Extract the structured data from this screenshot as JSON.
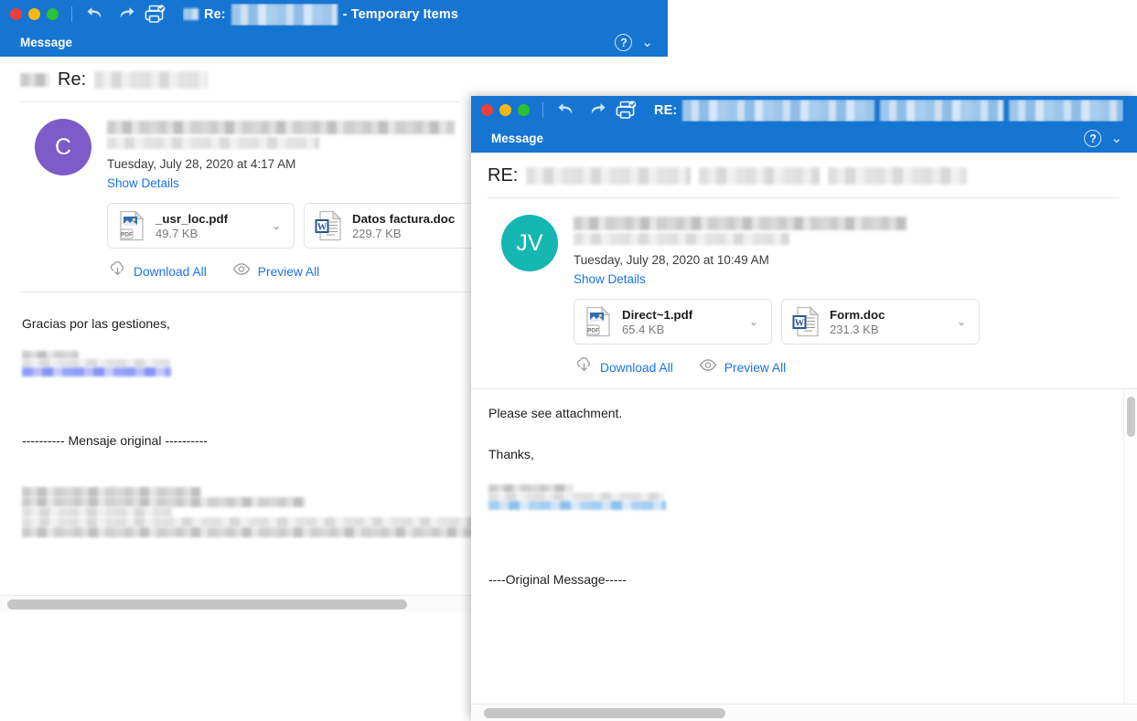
{
  "window1": {
    "titlebar": {
      "prefix_redacted": true,
      "subject_prefix": "Re:",
      "subject_suffix": "- Temporary Items",
      "menu_label": "Message",
      "help_icon": "question-mark-icon",
      "chevron_icon": "chevron-down-icon",
      "undo_icon": "undo-icon",
      "redo_icon": "redo-icon",
      "print_icon": "print-icon",
      "accent_color": "#1675d1"
    },
    "subject": {
      "prefix": "Re:"
    },
    "message": {
      "avatar_initials": "C",
      "avatar_color": "#7b5cc8",
      "date": "Tuesday, July 28, 2020 at 4:17 AM",
      "show_details": "Show Details",
      "attachments": [
        {
          "name": "_usr_loc.pdf",
          "size": "49.7 KB",
          "kind": "pdf"
        },
        {
          "name": "Datos factura.doc",
          "size": "229.7 KB",
          "kind": "doc"
        }
      ],
      "download_all": "Download All",
      "preview_all": "Preview All",
      "download_icon": "cloud-download-icon",
      "preview_icon": "eye-icon"
    },
    "body": {
      "greeting": "Gracias por las gestiones,",
      "separator": "---------- Mensaje original ----------"
    }
  },
  "window2": {
    "titlebar": {
      "subject_prefix": "RE:",
      "menu_label": "Message",
      "help_icon": "question-mark-icon",
      "chevron_icon": "chevron-down-icon",
      "undo_icon": "undo-icon",
      "redo_icon": "redo-icon",
      "print_icon": "print-icon",
      "accent_color": "#1675d1"
    },
    "subject": {
      "prefix": "RE:"
    },
    "message": {
      "avatar_initials": "JV",
      "avatar_color": "#16b6b2",
      "date": "Tuesday, July 28, 2020 at 10:49 AM",
      "show_details": "Show Details",
      "attachments": [
        {
          "name": "Direct~1.pdf",
          "size": "65.4 KB",
          "kind": "pdf"
        },
        {
          "name": "Form.doc",
          "size": "231.3 KB",
          "kind": "doc"
        }
      ],
      "download_all": "Download All",
      "preview_all": "Preview All",
      "download_icon": "cloud-download-icon",
      "preview_icon": "eye-icon"
    },
    "body": {
      "line1": "Please see attachment.",
      "line2": "Thanks,",
      "separator": "----Original Message-----"
    }
  }
}
